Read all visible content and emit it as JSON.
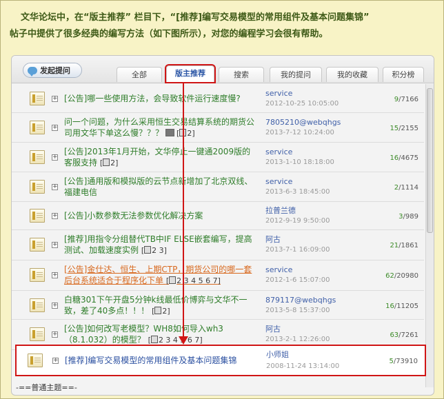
{
  "intro": {
    "line1": "文华论坛中，在“版主推荐” 栏目下，“[推荐]编写交易模型的常用组件及基本问题集锦”",
    "line2": "帖子中提供了很多经典的编写方法（如下图所示），对您的编程学习会很有帮助。"
  },
  "toolbar": {
    "ask_label": "发起提问",
    "tabs": [
      "全部",
      "版主推荐",
      "搜索",
      "我的提问",
      "我的收藏",
      "积分榜"
    ],
    "active_tab": "版主推荐"
  },
  "threads": [
    {
      "title": "[公告]哪一些使用方法，会导致软件运行速度慢?",
      "author": "service",
      "date": "2012-10-25 10:05:00",
      "replies": "9",
      "views": "7166"
    },
    {
      "title": "问一个问题，为什么采用恒生交易结算系统的期货公司用文华下单这么慢？？？",
      "pages": "2",
      "author": "7805210@webqhgs",
      "date": "2013-7-12 10:24:00",
      "replies": "15",
      "views": "2155"
    },
    {
      "title": "[公告]2013年1月开始，文华停止一键通2009版的客服支持",
      "pages": "2",
      "author": "service",
      "date": "2013-1-10 18:18:00",
      "replies": "16",
      "views": "4675"
    },
    {
      "title": "[公告]通用版和模拟版的云节点新增加了北京双线、福建电信",
      "author": "service",
      "date": "2013-6-3 18:45:00",
      "replies": "2",
      "views": "1114"
    },
    {
      "title": "[公告]小数参数无法参数优化解决方案",
      "author": "拉普兰德",
      "date": "2012-9-19 9:50:00",
      "replies": "3",
      "views": "989"
    },
    {
      "title": "[推荐]用指令分组替代TB中IF ELSE嵌套编写，提高测试、加载速度实例",
      "pages": "2 3",
      "author": "阿古",
      "date": "2013-7-1 16:09:00",
      "replies": "21",
      "views": "1861"
    },
    {
      "title": "[公告]金仕达、恒生、上期CTP，期货公司的哪一套后台系统适合于程序化下单",
      "pages": "2 3 4 5 6 7",
      "author": "service",
      "date": "2012-1-6 15:07:00",
      "replies": "62",
      "views": "20980"
    },
    {
      "title": "白糖301下午开盘5分钟k线最低价博弈与文华不一致，差了40多点！！！",
      "pages": "2",
      "author": "879117@webqhgs",
      "date": "2013-5-8 15:37:00",
      "replies": "16",
      "views": "11205"
    },
    {
      "title": "[公告]如何改写老模型？WH8如何导入wh3（8.1.032）的模型？",
      "pages": "2 3 4 5 6 7",
      "author": "阿古",
      "date": "2013-2-1 12:26:00",
      "replies": "63",
      "views": "7261"
    }
  ],
  "highlighted_thread": {
    "title": "[推荐]编写交易模型的常用组件及基本问题集锦",
    "author": "小师姐",
    "date": "2008-11-24 13:14:00",
    "replies": "5",
    "views": "73910"
  },
  "footer": {
    "label": "-==普通主题==-"
  }
}
